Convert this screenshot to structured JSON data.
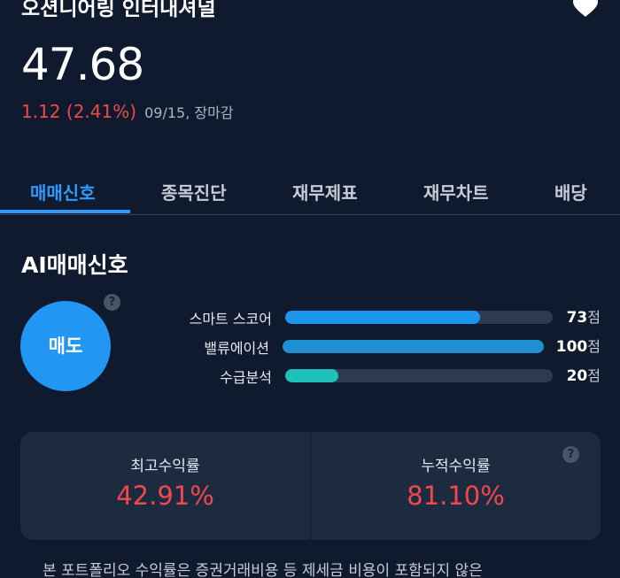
{
  "stock": {
    "name": "오션니어링 인터내셔널",
    "price": "47.68",
    "change": "1.12 (2.41%)",
    "date_status": "09/15, 장마감",
    "favorite_icon": "heart-icon"
  },
  "tabs": [
    {
      "label": "매매신호",
      "active": true
    },
    {
      "label": "종목진단",
      "active": false
    },
    {
      "label": "재무제표",
      "active": false
    },
    {
      "label": "재무차트",
      "active": false
    },
    {
      "label": "배당",
      "active": false
    }
  ],
  "ai_signal": {
    "title": "AI매매신호",
    "signal": "매도",
    "help_icon": "question-icon",
    "help_glyph": "?",
    "metrics": [
      {
        "label": "스마트 스코어",
        "value": 73,
        "unit": "점",
        "color": "#1e96f0"
      },
      {
        "label": "밸류에이션",
        "value": 100,
        "unit": "점",
        "color": "#1e8fcf"
      },
      {
        "label": "수급분석",
        "value": 20,
        "unit": "점",
        "color": "#1cc1b8"
      }
    ]
  },
  "returns": {
    "max_label": "최고수익률",
    "max_value": "42.91%",
    "cumulative_label": "누적수익률",
    "cumulative_value": "81.10%"
  },
  "disclaimer": "본 포트폴리오 수익률은 증권거래비용 등 제세금 비용이 포함되지 않은"
}
